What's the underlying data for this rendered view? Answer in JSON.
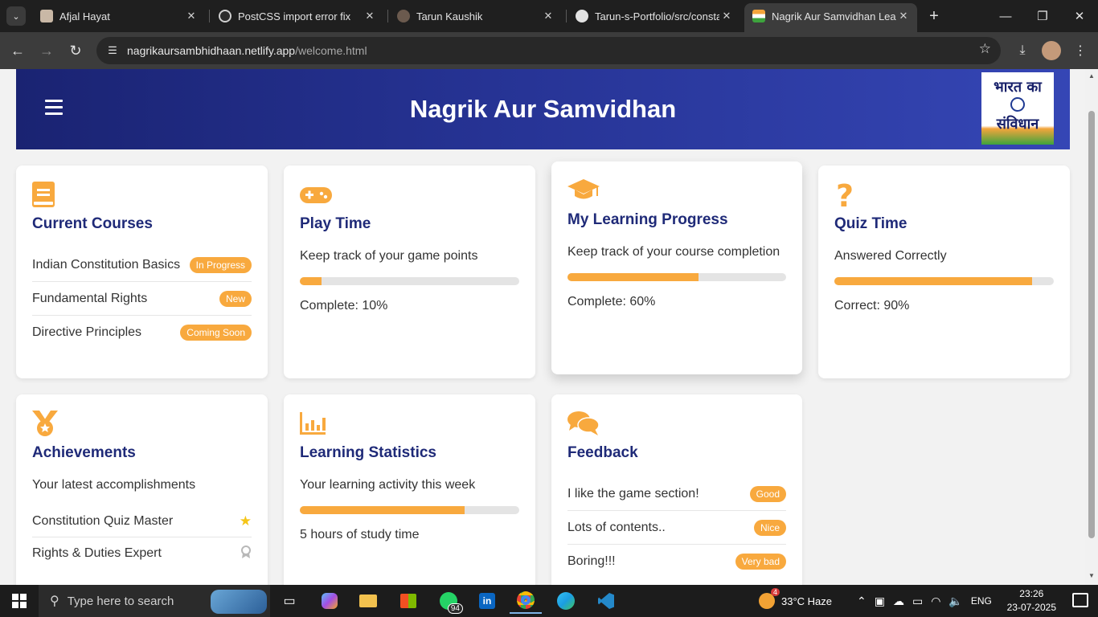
{
  "browser": {
    "tabs": [
      {
        "title": "Afjal Hayat",
        "close": "✕"
      },
      {
        "title": "PostCSS import error fix",
        "close": "✕"
      },
      {
        "title": "Tarun Kaushik",
        "close": "✕"
      },
      {
        "title": "Tarun-s-Portfolio/src/constan",
        "close": "✕"
      },
      {
        "title": "Nagrik Aur Samvidhan Learn",
        "close": "✕"
      }
    ],
    "url_host": "nagrikaursambhidhaan.netlify.app",
    "url_path": "/welcome.html"
  },
  "page": {
    "title": "Nagrik Aur Samvidhan",
    "logo_line1": "भारत का",
    "logo_line2": "संविधान",
    "accent": "#f8a93e",
    "heading_color": "#1f2a78"
  },
  "courses": {
    "title": "Current Courses",
    "items": [
      {
        "label": "Indian Constitution Basics",
        "badge": "In Progress"
      },
      {
        "label": "Fundamental Rights",
        "badge": "New"
      },
      {
        "label": "Directive Principles",
        "badge": "Coming Soon"
      }
    ]
  },
  "playtime": {
    "title": "Play Time",
    "desc": "Keep track of your game points",
    "progress": 10,
    "foot": "Complete: 10%"
  },
  "progress": {
    "title": "My Learning Progress",
    "desc": "Keep track of your course completion",
    "progress": 60,
    "foot": "Complete: 60%"
  },
  "quiz": {
    "title": "Quiz Time",
    "desc": "Answered Correctly",
    "progress": 90,
    "foot": "Correct: 90%"
  },
  "achievements": {
    "title": "Achievements",
    "desc": "Your latest accomplishments",
    "items": [
      {
        "label": "Constitution Quiz Master",
        "icon": "star-icon",
        "glyph": "★"
      },
      {
        "label": "Rights & Duties Expert",
        "icon": "medal-icon",
        "glyph": "🎖"
      }
    ]
  },
  "stats": {
    "title": "Learning Statistics",
    "desc": "Your learning activity this week",
    "progress": 75,
    "foot": "5 hours of study time"
  },
  "feedback": {
    "title": "Feedback",
    "items": [
      {
        "label": "I like the game section!",
        "badge": "Good"
      },
      {
        "label": "Lots of contents..",
        "badge": "Nice"
      },
      {
        "label": "Boring!!!",
        "badge": "Very bad"
      }
    ]
  },
  "taskbar": {
    "search_placeholder": "Type here to search",
    "whatsapp_count": "94",
    "weather_alert": "4",
    "weather": "33°C  Haze",
    "lang": "ENG",
    "time": "23:26",
    "date": "23-07-2025"
  }
}
